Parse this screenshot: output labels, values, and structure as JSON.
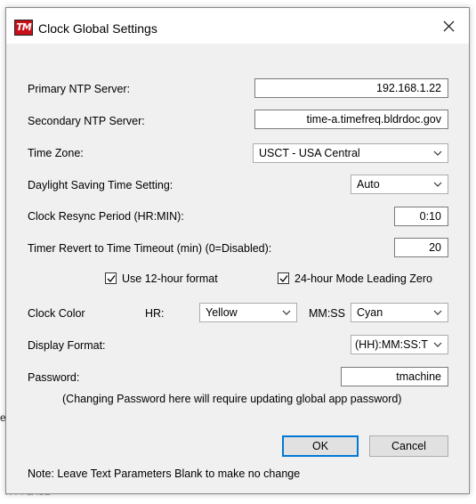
{
  "window": {
    "title": "Clock Global Settings",
    "icon_text": "TM"
  },
  "fields": {
    "primary_ntp_label": "Primary NTP Server:",
    "primary_ntp_value": "192.168.1.22",
    "secondary_ntp_label": "Secondary NTP Server:",
    "secondary_ntp_value": "time-a.timefreq.bldrdoc.gov",
    "time_zone_label": "Time Zone:",
    "time_zone_value": "USCT - USA Central",
    "dst_label": "Daylight Saving Time Setting:",
    "dst_value": "Auto",
    "resync_label": "Clock Resync Period (HR:MIN):",
    "resync_value": "0:10",
    "revert_label": "Timer Revert to Time Timeout (min) (0=Disabled):",
    "revert_value": "20",
    "use12_label": "Use 12-hour format",
    "use12_checked": true,
    "leading_zero_label": "24-hour Mode Leading Zero",
    "leading_zero_checked": true,
    "clock_color_label": "Clock Color",
    "hr_label": "HR:",
    "hr_color": "Yellow",
    "mmss_label": "MM:SS",
    "mmss_color": "Cyan",
    "display_format_label": "Display Format:",
    "display_format_value": "(HH):MM:SS:T",
    "password_label": "Password:",
    "password_value": "tmachine",
    "password_hint": "(Changing Password here will require updating global app password)"
  },
  "buttons": {
    "ok": "OK",
    "cancel": "Cancel"
  },
  "note": "Note: Leave Text Parameters Blank to make no change",
  "background_fragments": {
    "left_char": "e",
    "bottom_text": "ITT PLACE"
  },
  "colors": {
    "accent": "#0078d7",
    "dialog_bg": "#f0f0f0",
    "icon_red": "#c8101a"
  }
}
